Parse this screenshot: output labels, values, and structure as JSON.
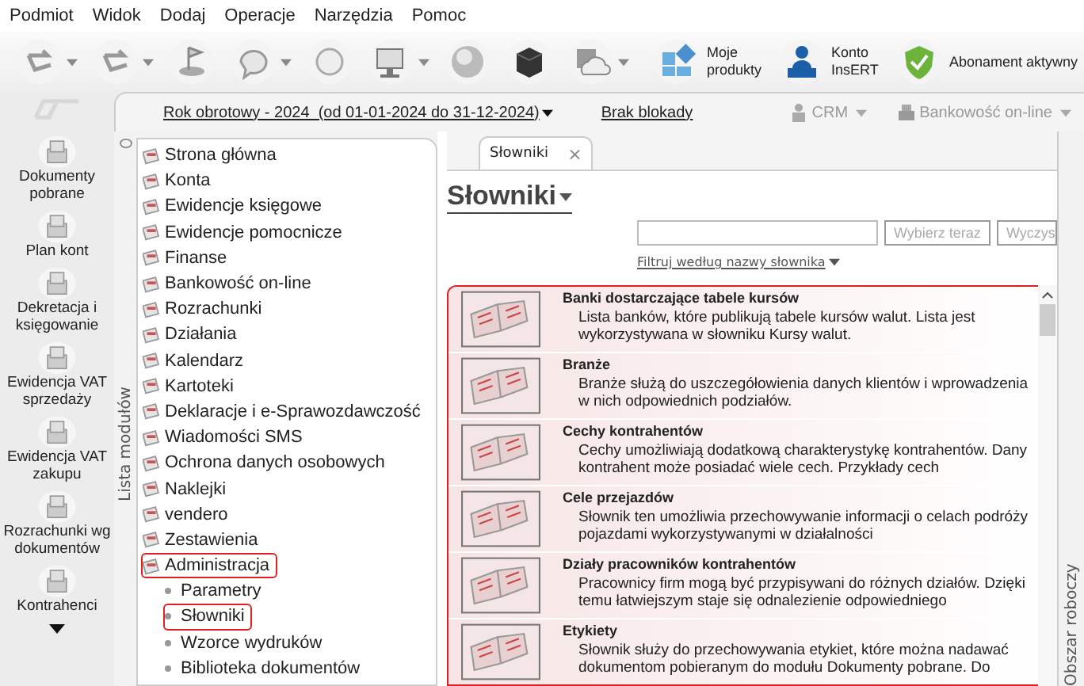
{
  "menu": [
    "Podmiot",
    "Widok",
    "Dodaj",
    "Operacje",
    "Narzędzia",
    "Pomoc"
  ],
  "toolbar": {
    "tools": [
      {
        "kind": "arrow",
        "caret": true
      },
      {
        "kind": "arrow",
        "caret": true
      },
      {
        "kind": "flag",
        "caret": false
      },
      {
        "kind": "chat",
        "caret": true
      },
      {
        "kind": "ins",
        "caret": false
      },
      {
        "kind": "monitor",
        "caret": true
      },
      {
        "kind": "globe",
        "caret": false
      },
      {
        "kind": "cube",
        "caret": false
      },
      {
        "kind": "cloud",
        "caret": true
      }
    ],
    "buttons": [
      {
        "kind": "products",
        "lines": [
          "Moje",
          "produkty"
        ]
      },
      {
        "kind": "account",
        "lines": [
          "Konto",
          "InsERT"
        ]
      },
      {
        "kind": "shield",
        "lines": [
          "Abonament aktywny"
        ]
      }
    ]
  },
  "shortcuts": [
    "Dokumenty pobrane",
    "Plan kont",
    "Dekretacja i księgowanie",
    "Ewidencja VAT sprzedaży",
    "Ewidencja VAT zakupu",
    "Rozrachunki wg dokumentów",
    "Kontrahenci"
  ],
  "topbar": {
    "year": "Rok obrotowy - 2024  (od 01-01-2024 do 31-12-2024)",
    "lock": "Brak blokady",
    "crm": "CRM",
    "bank": "Bankowość on-line"
  },
  "module_list": {
    "title": "Lista modułów",
    "items": [
      {
        "label": "Strona główna",
        "selected": false
      },
      {
        "label": "Konta",
        "selected": false
      },
      {
        "label": "Ewidencje księgowe",
        "selected": false
      },
      {
        "label": "Ewidencje pomocnicze",
        "selected": false
      },
      {
        "label": "Finanse",
        "selected": false
      },
      {
        "label": "Bankowość on-line",
        "selected": false
      },
      {
        "label": "Rozrachunki",
        "selected": false
      },
      {
        "label": "Działania",
        "selected": false
      },
      {
        "label": "Kalendarz",
        "selected": false
      },
      {
        "label": "Kartoteki",
        "selected": false
      },
      {
        "label": "Deklaracje i e-Sprawozdawczość",
        "selected": false
      },
      {
        "label": "Wiadomości SMS",
        "selected": false
      },
      {
        "label": "Ochrona danych osobowych",
        "selected": false
      },
      {
        "label": "Naklejki",
        "selected": false
      },
      {
        "label": "vendero",
        "selected": false
      },
      {
        "label": "Zestawienia",
        "selected": false
      },
      {
        "label": "Administracja",
        "selected": true,
        "children": [
          {
            "label": "Parametry",
            "selected": false
          },
          {
            "label": "Słowniki",
            "selected": true
          },
          {
            "label": "Wzorce wydruków",
            "selected": false
          },
          {
            "label": "Biblioteka dokumentów",
            "selected": false
          }
        ]
      }
    ]
  },
  "tabs": [
    {
      "label": "Słowniki",
      "selected": true,
      "close": "×"
    }
  ],
  "page": {
    "title": "Słowniki",
    "search": {
      "button": "Wybierz teraz",
      "clear": "Wyczys"
    },
    "filter": "Filtruj według nazwy słownika"
  },
  "dictionaries": [
    {
      "title": "Banki dostarczające tabele kursów",
      "text": "Lista banków, które publikują tabele kursów walut. Lista jest wykorzystywana w słowniku Kursy walut."
    },
    {
      "title": "Branże",
      "text": "Branże służą do uszczegółowienia danych klientów i wprowadzenia w nich odpowiednich podziałów."
    },
    {
      "title": "Cechy kontrahentów",
      "text": "Cechy umożliwiają dodatkową charakterystykę kontrahentów. Dany kontrahent może posiadać wiele cech. Przykłady cech"
    },
    {
      "title": "Cele przejazdów",
      "text": "Słownik ten umożliwia przechowywanie informacji o celach podróży pojazdami wykorzystywanymi w działalności"
    },
    {
      "title": "Działy pracowników kontrahentów",
      "text": "Pracownicy firm mogą być przypisywani do różnych działów. Dzięki temu łatwiejszym staje się odnalezienie odpowiedniego"
    },
    {
      "title": "Etykiety",
      "text": "Słownik służy do przechowywania etykiet, które można nadawać dokumentom pobieranym do modułu Dokumenty pobrane. Do"
    }
  ],
  "right_panel": {
    "title": "Obszar roboczy"
  }
}
